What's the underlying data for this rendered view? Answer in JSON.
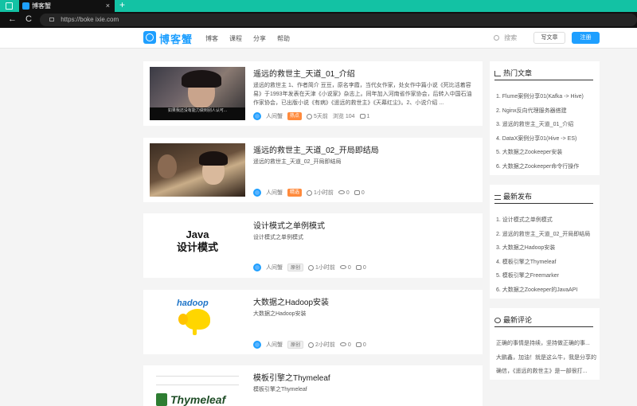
{
  "browser": {
    "tab_title": "博客蟹",
    "tab_close": "×",
    "new_tab": "+",
    "back": "←",
    "reload": "C",
    "url": "https://boke ixie.com"
  },
  "header": {
    "logo_text": "博客蟹",
    "nav": [
      "博客",
      "课程",
      "分享",
      "帮助"
    ],
    "search_placeholder": "搜索",
    "write_label": "写文章",
    "login_label": "注册"
  },
  "articles": [
    {
      "title": "遥远的救世主_天道_01_介绍",
      "summary": "遥远的救世主 1、作者简介 豆豆，原名李霞，当代女作家，处女作中篇小说《死比活着容易》于1993年发表在天津《小说家》杂志上。同年加入河南省作家协会，后转入中国石油作家协会，已出版小说《有病》《遥远的救世主》《天幕红尘》。2、小说介绍 ...",
      "subtitle": "如果我还没有能力做到别人认可...",
      "badge": "热点",
      "badge_style": "orange",
      "time": "5天前",
      "views": "浏览 104",
      "comments": "1"
    },
    {
      "title": "遥远的救世主_天道_02_开局即结局",
      "summary": "遥远的救世主_天道_02_开局即结局",
      "subtitle": "",
      "badge": "精选",
      "badge_style": "orange",
      "time": "1小时前",
      "views": "0",
      "comments": "0"
    },
    {
      "title": "设计模式之单例模式",
      "summary": "设计模式之单例模式",
      "thumb_line1": "Java",
      "thumb_line2": "设计模式",
      "badge": "原创",
      "badge_style": "gray",
      "time": "1小时前",
      "views": "0",
      "comments": "0"
    },
    {
      "title": "大数据之Hadoop安装",
      "summary": "大数据之Hadoop安装",
      "thumb_text": "hadoop",
      "badge": "原创",
      "badge_style": "gray",
      "time": "2小时前",
      "views": "0",
      "comments": "0"
    },
    {
      "title": "模板引擎之Thymeleaf",
      "summary": "模板引擎之Thymeleaf",
      "thumb_text": "Thymeleaf"
    }
  ],
  "author": "人间蟹",
  "sidebar": {
    "hot": {
      "title": "热门文章",
      "items": [
        "1. Flume案例分享01(Kafka -> Hive)",
        "2. Nginx反向代理服务器搭建",
        "3. 遥远的救世主_天道_01_介绍",
        "4. DataX案例分享01(Hive -> ES)",
        "5. 大数据之Zookeeper安装",
        "6. 大数据之Zookeeper命令行操作"
      ]
    },
    "latest": {
      "title": "最新发布",
      "items": [
        "1. 设计模式之单例模式",
        "2. 遥远的救世主_天道_02_开局即结局",
        "3. 大数据之Hadoop安装",
        "4. 模板引擎之Thymeleaf",
        "5. 模板引擎之Freemarker",
        "6. 大数据之Zookeeper的JavaAPI"
      ]
    },
    "comments": {
      "title": "最新评论",
      "items": [
        "正确的事情是持续，坚持做正确的事...",
        "大鹏鑫，加油！就是这么牛，我是分享的...",
        "确信，《遥远的救世主》是一部很打..."
      ]
    }
  },
  "colors": {
    "accent": "#1e9fff",
    "browser_tab_bar": "#13c2a4",
    "badge_orange": "#ff8a3c"
  }
}
